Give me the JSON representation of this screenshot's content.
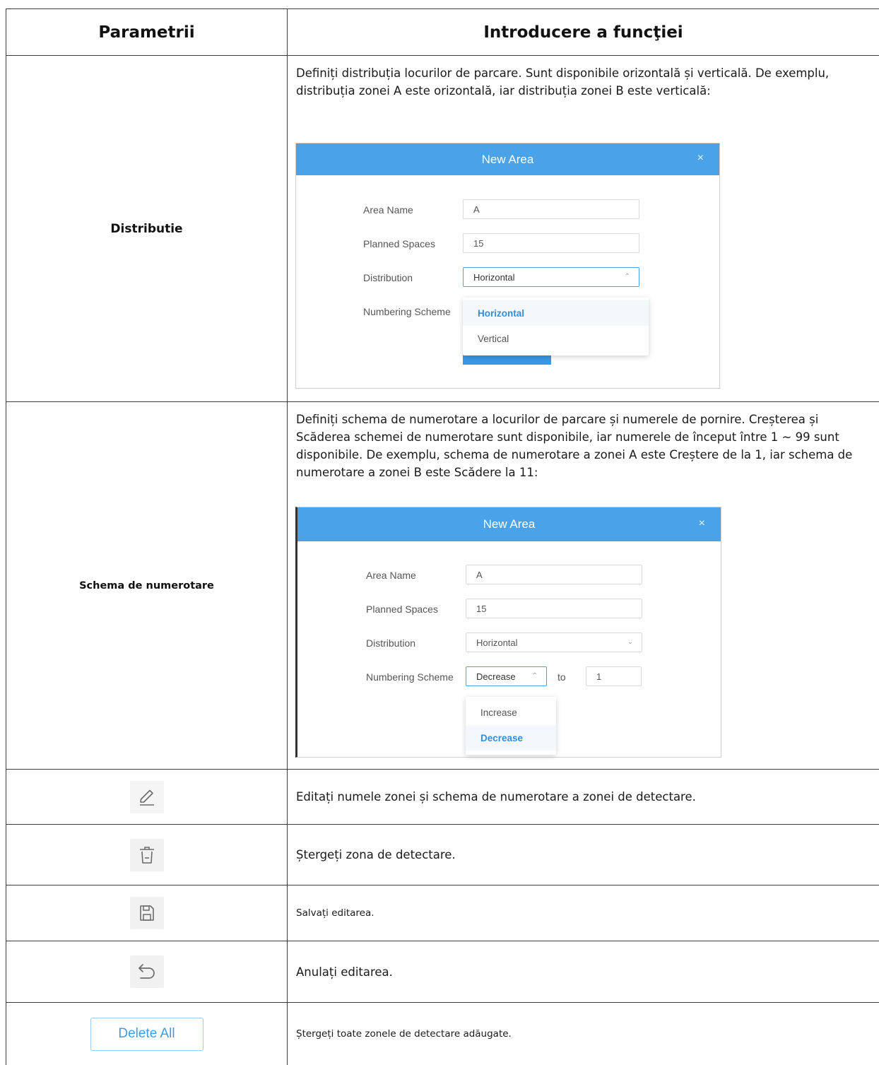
{
  "table": {
    "headers": {
      "param": "Parametrii",
      "desc": "Introducere a funcţiei"
    },
    "rows": {
      "distributie": {
        "param": "Distributie",
        "desc": "Definiți distribuția locurilor de parcare. Sunt disponibile orizontală și verticală. De exemplu, distribuția zonei A este orizontală, iar distribuția zonei B este verticală:"
      },
      "schema": {
        "param": "Schema de numerotare",
        "desc": "Definiți schema de numerotare a locurilor de parcare și numerele de pornire. Creșterea și Scăderea schemei de numerotare sunt disponibile, iar numerele de început între 1 ~ 99 sunt disponibile. De exemplu, schema de numerotare a zonei A este Creștere de la 1, iar schema de numerotare a zonei B este Scădere la 11:"
      },
      "edit": {
        "icon": "pencil-icon",
        "desc": "Editați numele zonei și schema de numerotare a zonei de detectare."
      },
      "delete": {
        "icon": "trash-icon",
        "desc": "Ștergeți zona de detectare."
      },
      "save": {
        "icon": "save-icon",
        "desc": "Salvați editarea."
      },
      "undo": {
        "icon": "undo-icon",
        "desc": "Anulați editarea."
      },
      "delete_all": {
        "button_label": "Delete All",
        "desc": "Ștergeți toate zonele de detectare adăugate."
      }
    }
  },
  "dialog1": {
    "title": "New Area",
    "close": "×",
    "fields": {
      "area_name": {
        "label": "Area Name",
        "value": "A"
      },
      "planned_spaces": {
        "label": "Planned Spaces",
        "value": "15"
      },
      "distribution": {
        "label": "Distribution",
        "value": "Horizontal"
      },
      "numbering_scheme": {
        "label": "Numbering Scheme"
      }
    },
    "dropdown_options": [
      "Horizontal",
      "Vertical"
    ],
    "selected_option": "Horizontal"
  },
  "dialog2": {
    "title": "New Area",
    "close": "×",
    "fields": {
      "area_name": {
        "label": "Area Name",
        "value": "A"
      },
      "planned_spaces": {
        "label": "Planned Spaces",
        "value": "15"
      },
      "distribution": {
        "label": "Distribution",
        "value": "Horizontal"
      },
      "numbering_scheme": {
        "label": "Numbering Scheme",
        "value": "Decrease",
        "to_label": "to",
        "start_value": "1"
      }
    },
    "dropdown_options": [
      "Increase",
      "Decrease"
    ],
    "selected_option": "Decrease"
  },
  "colors": {
    "accent": "#4aa3e8",
    "selected_text": "#2f8fe0",
    "grid": "#3c3c3c"
  }
}
